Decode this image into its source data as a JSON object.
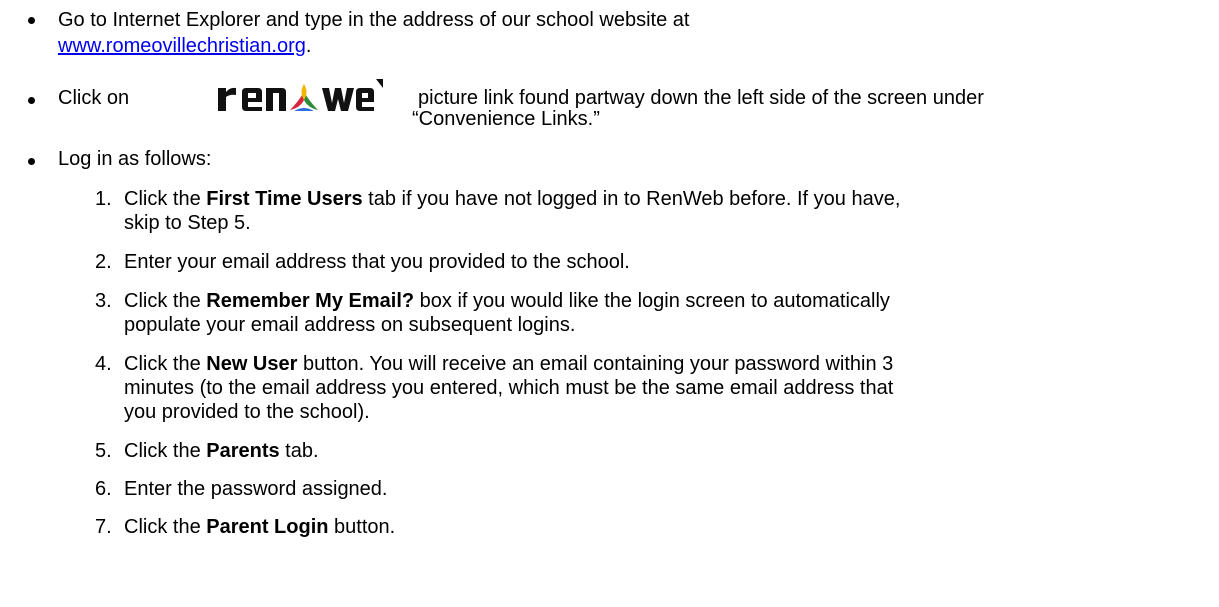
{
  "bullets": {
    "b1": {
      "line1": "Go to Internet Explorer and type in the address of our school website at",
      "link": "www.romeovillechristian.org",
      "after_link": "."
    },
    "b2": {
      "pre": "Click on",
      "logo_text": "renweb",
      "line1": "picture link found partway down the left side of the screen under",
      "line2": "“Convenience Links.”"
    },
    "b3": {
      "text": "Log in as follows:"
    }
  },
  "steps": [
    {
      "number": "1.",
      "pre": "Click the ",
      "bold": "First Time Users",
      "line1_post": " tab if you have not logged in to RenWeb before.  If you have,",
      "line2": "skip to Step 5."
    },
    {
      "number": "2.",
      "text": "Enter your email address that you provided to the school."
    },
    {
      "number": "3.",
      "pre": "Click the ",
      "bold": "Remember My Email?",
      "line1_post": " box if you would like the login screen to automatically",
      "line2": "populate your email address on subsequent logins."
    },
    {
      "number": "4.",
      "pre": "Click the ",
      "bold": "New User",
      "line1_post": " button.  You will receive an email containing your password within 3",
      "line2": "minutes (to the email address you entered, which must be the same email address that",
      "line3": "you provided to the school)."
    },
    {
      "number": "5.",
      "pre": "Click the ",
      "bold": "Parents",
      "post": " tab."
    },
    {
      "number": "6.",
      "text": "Enter the password assigned."
    },
    {
      "number": "7.",
      "pre": "Click the ",
      "bold": "Parent Login",
      "post": " button."
    }
  ],
  "colors": {
    "link": "#0000ee",
    "logo_text": "#111111",
    "logo_leaf_red": "#d7263d",
    "logo_leaf_green": "#2e8b3a",
    "logo_leaf_yellow": "#f2b705",
    "logo_leaf_blue": "#2a6fdb"
  }
}
